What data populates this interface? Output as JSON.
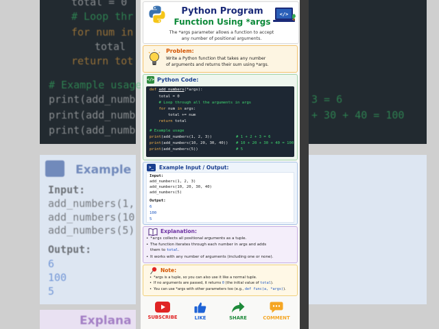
{
  "header": {
    "title_line1": "Python Program",
    "title_line2": "Function Using *args",
    "description_line1": "The *args parameter allows a function to accept",
    "description_line2": "any number of positional arguments."
  },
  "problem": {
    "title": "Problem:",
    "line1": "Write a Python function that takes any number",
    "line2": "of arguments and returns their sum using *args."
  },
  "code_section": {
    "title": "Python Code:",
    "icon": "code-icon",
    "lines": {
      "def_kw": "def ",
      "def_name": "add_numbers",
      "def_rest": "(*args):",
      "l2": "    total = 0",
      "l3": "    # Loop through all the arguments in args",
      "l4_kw1": "    for ",
      "l4_mid": "num ",
      "l4_kw2": "in ",
      "l4_end": "args:",
      "l5": "        total += num",
      "l6_kw": "    return ",
      "l6_end": "total",
      "l7": "# Example usage",
      "p1_kw": "print",
      "p1_rest": "(add_numbers(1, 2, 3))",
      "p1_cm": "# 1 + 2 + 3 = 6",
      "p2_kw": "print",
      "p2_rest": "(add_numbers(10, 20, 30, 40))",
      "p2_cm": "# 10 + 20 + 30 + 40 = 100",
      "p3_kw": "print",
      "p3_rest": "(add_numbers(5))",
      "p3_cm": "# 5"
    }
  },
  "io_section": {
    "title": "Example Input / Output:",
    "input_label": "Input:",
    "inputs": [
      "add_numbers(1, 2, 3)",
      "add_numbers(10, 20, 30, 40)",
      "add_numbers(5)"
    ],
    "output_label": "Output:",
    "outputs": [
      "6",
      "100",
      "5"
    ]
  },
  "explanation": {
    "title": "Explanation:",
    "b1_code": "*args",
    "b1_text": " collects all positional arguments as a tuple.",
    "b2_line1": "The function iterates through each number in args and adds",
    "b2_line2_pre": "them to ",
    "b2_line2_code": "total",
    "b2_line2_post": ".",
    "b3": "It works with any number of arguments (including one or none)."
  },
  "note": {
    "title": "Note:",
    "n1": "*args is a tuple, so you can also use it like a normal tuple.",
    "n2_pre": "If no arguments are passed, it returns ",
    "n2_code": "0",
    "n2_mid": " (the initial value of ",
    "n2_code2": "total",
    "n2_post": ").",
    "n3_pre": "You can use *args with other parameters too (e.g., ",
    "n3_code": "def func(a, *args)",
    "n3_post": ")."
  },
  "actions": {
    "subscribe": "SUBSCRIBE",
    "like": "LIKE",
    "share": "SHARE",
    "comment": "COMMENT"
  },
  "background": {
    "code_lines": [
      "total = 0",
      "# Loop thr",
      "for num in",
      "total",
      "return tot",
      "# Example usage",
      "print(add_numb",
      "print(add_numb",
      "print(add_numb"
    ],
    "right_code": [
      "3 = 6",
      "+ 30 + 40 = 100"
    ],
    "panel_title": "Example",
    "input_label": "Input:",
    "inputs": [
      "add_numbers(1,",
      "add_numbers(10",
      "add_numbers(5)"
    ],
    "output_label": "Output:",
    "outputs": [
      "6",
      "100",
      "5"
    ],
    "panel2_title": "Explana"
  },
  "colors": {
    "title_blue": "#1b2a78",
    "title_green": "#0e8a3a",
    "subscribe_red": "#e02424",
    "like_blue": "#1e63d6",
    "share_green": "#1e8a3a",
    "comment_orange": "#f5a623"
  }
}
